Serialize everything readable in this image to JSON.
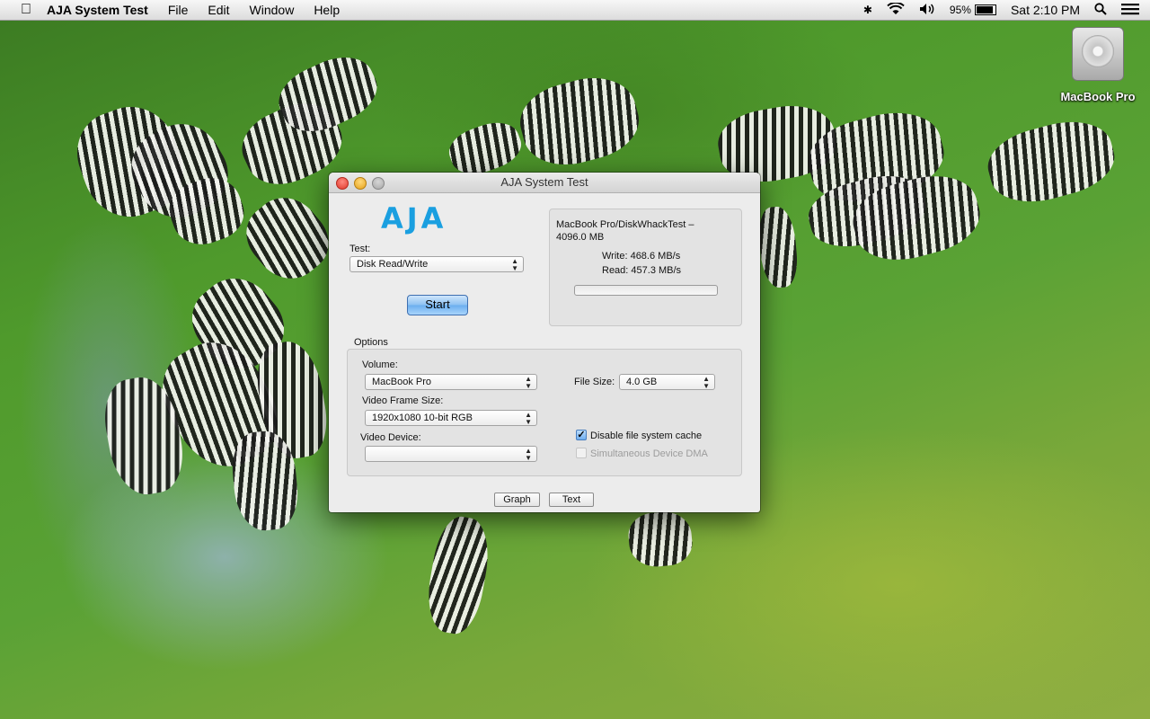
{
  "menubar": {
    "app_name": "AJA System Test",
    "menus": [
      "File",
      "Edit",
      "Window",
      "Help"
    ],
    "battery": "95%",
    "clock": "Sat 2:10 PM"
  },
  "desktop": {
    "disk_label": "MacBook Pro"
  },
  "window": {
    "title": "AJA System Test",
    "logo": "AJA",
    "test_label": "Test:",
    "test_value": "Disk Read/Write",
    "start_label": "Start",
    "results": {
      "target": "MacBook Pro/DiskWhackTest –",
      "size": "4096.0 MB",
      "write": "Write: 468.6 MB/s",
      "read": "Read: 457.3 MB/s",
      "progress": 0
    },
    "options": {
      "title": "Options",
      "volume_label": "Volume:",
      "volume_value": "MacBook Pro",
      "frame_size_label": "Video Frame Size:",
      "frame_size_value": "1920x1080 10-bit RGB",
      "device_label": "Video Device:",
      "device_value": "",
      "file_size_label": "File Size:",
      "file_size_value": "4.0 GB",
      "disable_cache_label": "Disable file system cache",
      "disable_cache_checked": true,
      "dma_label": "Simultaneous Device DMA",
      "dma_checked": false
    },
    "graph_label": "Graph",
    "text_label": "Text"
  },
  "colors": {
    "logo": "#1a9fe0",
    "start_button": "#6aaeef"
  }
}
